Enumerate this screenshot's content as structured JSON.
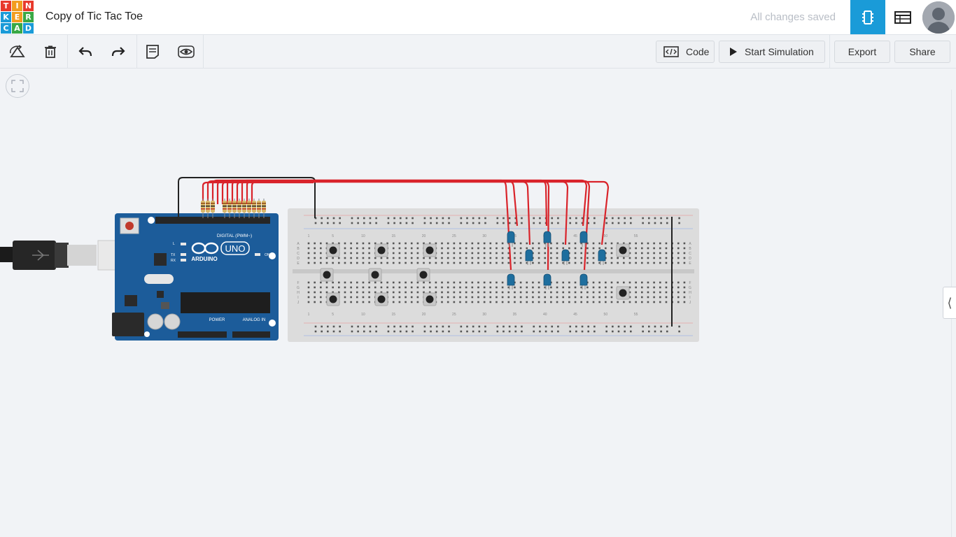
{
  "app": {
    "logo_letters": [
      "T",
      "I",
      "N",
      "K",
      "E",
      "R",
      "C",
      "A",
      "D"
    ],
    "logo_colors": [
      "#e8392b",
      "#f29d1f",
      "#e8392b",
      "#1a9bd8",
      "#f29d1f",
      "#39a845",
      "#1a9bd8",
      "#39a845",
      "#1a9bd8"
    ],
    "project_title": "Copy of Tic Tac Toe",
    "save_status": "All changes saved"
  },
  "toolbar": {
    "code_label": "Code",
    "simulate_label": "Start Simulation",
    "export_label": "Export",
    "share_label": "Share"
  },
  "board": {
    "name": "UNO",
    "brand": "ARDUINO",
    "digital_label": "DIGITAL (PWM~)",
    "power_label": "POWER",
    "analog_label": "ANALOG IN",
    "on_label": "ON",
    "l_label": "L",
    "tx_label": "TX",
    "rx_label": "RX",
    "aref_label": "AREF",
    "gnd_label": "GND"
  },
  "breadboard": {
    "column_numbers": [
      "1",
      "5",
      "10",
      "15",
      "20",
      "25",
      "30",
      "35",
      "40",
      "45",
      "50",
      "55"
    ],
    "row_letters_top": [
      "A",
      "B",
      "C",
      "D",
      "E"
    ],
    "row_letters_bottom": [
      "F",
      "G",
      "H",
      "I",
      "J"
    ]
  },
  "colors": {
    "accent": "#1a9bd8",
    "wire_red": "#d9232a",
    "wire_black": "#222222",
    "board_blue": "#1c5c9a",
    "led_blue": "#1e6e9e"
  }
}
